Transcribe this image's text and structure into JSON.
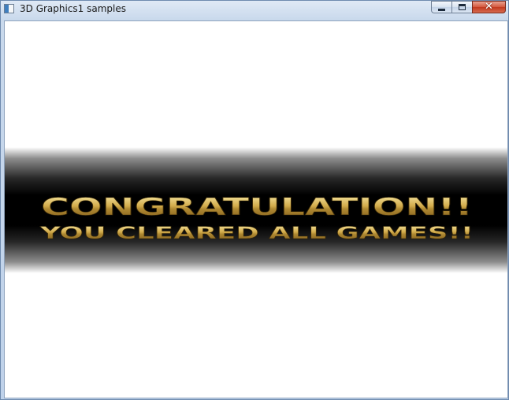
{
  "window": {
    "title": "3D Graphics1 samples",
    "icon": "app-window-icon",
    "controls": {
      "minimize": "minimize-icon",
      "maximize": "maximize-icon",
      "close": "close-icon",
      "close_glyph": "✕"
    }
  },
  "game": {
    "headline": "CONGRATULATION!!",
    "subline": "YOU CLEARED ALL GAMES!!",
    "colors": {
      "band": "#000000",
      "gold_light": "#f8eaa8",
      "gold_mid": "#d2ab4a",
      "gold_dark": "#7a5516",
      "background": "#ffffff"
    }
  }
}
